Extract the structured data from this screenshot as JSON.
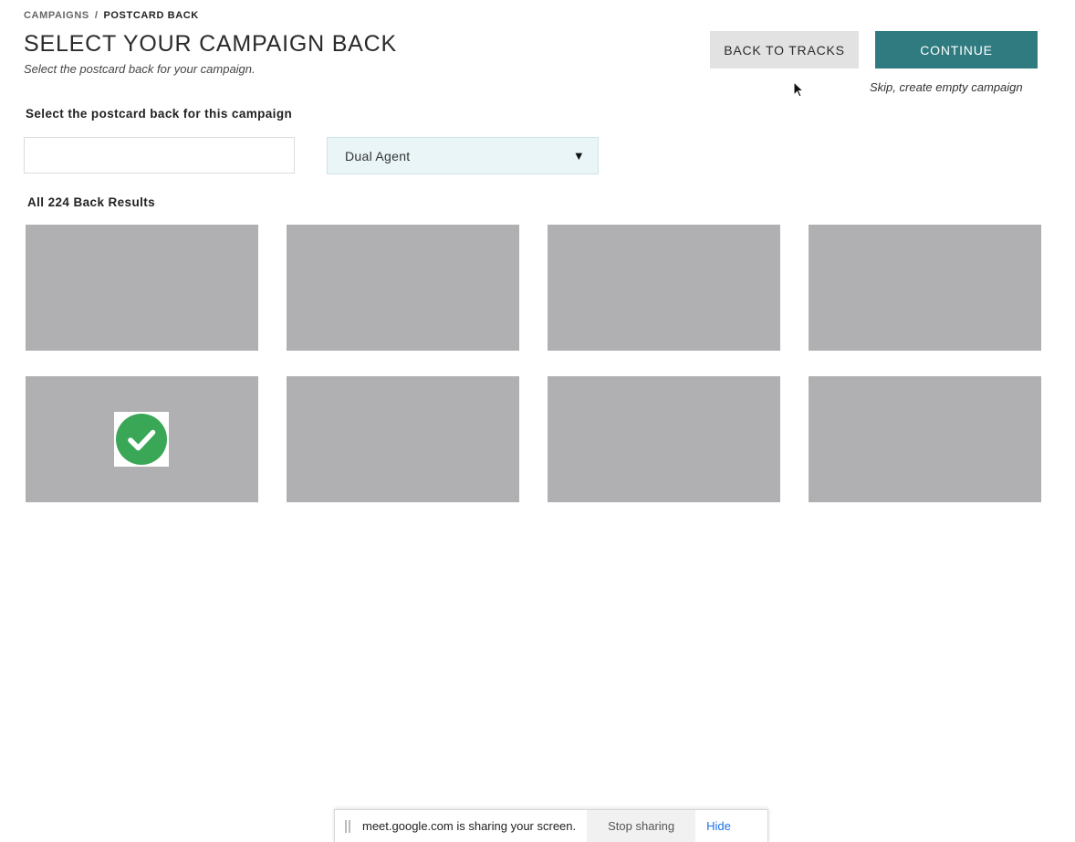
{
  "breadcrumb": {
    "parent": "CAMPAIGNS",
    "separator": "/",
    "current": "POSTCARD BACK"
  },
  "header": {
    "title": "SELECT YOUR CAMPAIGN BACK",
    "subtitle": "Select the postcard back for your campaign."
  },
  "actions": {
    "back_label": "BACK TO TRACKS",
    "continue_label": "CONTINUE",
    "skip_label": "Skip, create empty campaign"
  },
  "filters": {
    "section_label": "Select the postcard back for this campaign",
    "search_value": "",
    "select_value": "Dual Agent",
    "select_arrow": "▼"
  },
  "results": {
    "count_label": "All 224 Back Results",
    "cards": [
      {
        "selected": false
      },
      {
        "selected": false
      },
      {
        "selected": false
      },
      {
        "selected": false
      },
      {
        "selected": true
      },
      {
        "selected": false
      },
      {
        "selected": false
      },
      {
        "selected": false
      }
    ]
  },
  "share_bar": {
    "message": "meet.google.com is sharing your screen.",
    "stop_label": "Stop sharing",
    "hide_label": "Hide"
  },
  "colors": {
    "accent": "#2f7b80",
    "card": "#b0b0b3",
    "check": "#3aa757",
    "link": "#1a73e8"
  },
  "icons": {
    "selected": "check-circle-icon",
    "cursor": "mouse-cursor-icon",
    "dropdown": "triangle-down-icon"
  }
}
